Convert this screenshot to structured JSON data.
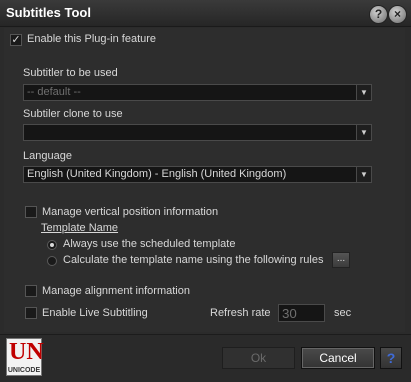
{
  "window": {
    "title": "Subtitles Tool",
    "help_glyph": "?",
    "close_glyph": "×"
  },
  "plugin": {
    "enable_label": "Enable this Plug-in feature",
    "enable_checked": true
  },
  "subtitler": {
    "label": "Subtitler to be used",
    "value": "-- default --"
  },
  "clone": {
    "label": "Subtiler clone to use",
    "value": ""
  },
  "language": {
    "label": "Language",
    "value": "English (United Kingdom) - English (United Kingdom)"
  },
  "vertical": {
    "label": "Manage vertical position information",
    "checked": false,
    "template_heading": "Template Name",
    "option_always": "Always use the scheduled template",
    "option_calculate": "Calculate the template name using the following rules",
    "selected": "always",
    "rules_button": "..."
  },
  "alignment": {
    "label": "Manage alignment information",
    "checked": false
  },
  "live": {
    "label": "Enable Live Subtitling",
    "checked": false,
    "refresh_label": "Refresh rate",
    "refresh_value": "30",
    "refresh_unit": "sec"
  },
  "footer": {
    "logo_letters": "UN",
    "logo_text": "UNICODE",
    "ok_label": "Ok",
    "cancel_label": "Cancel",
    "help_glyph": "?"
  },
  "colors": {
    "background": "#2b2b2b",
    "text": "#d8d8d8",
    "logo_red": "#c00000",
    "help_blue": "#3f6bd8"
  }
}
